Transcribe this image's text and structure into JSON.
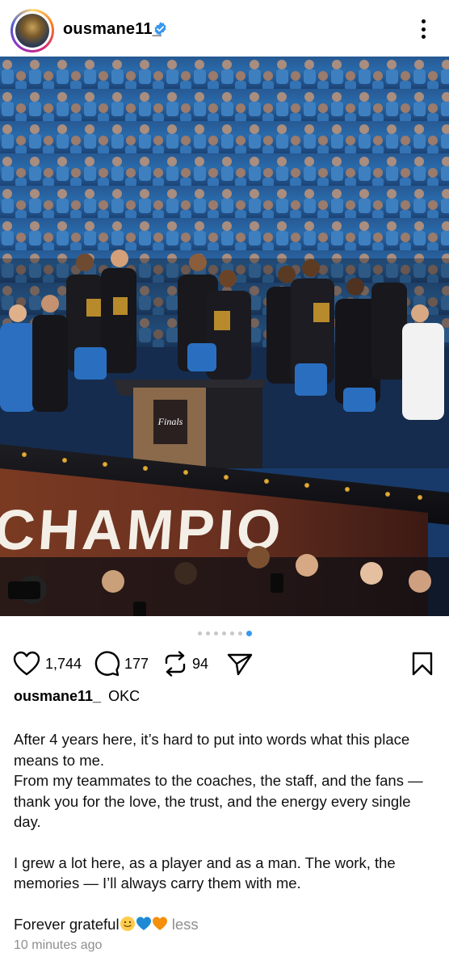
{
  "post": {
    "username": "ousmane11_",
    "location": "OKC",
    "image_banner_text": "CHAMPIO",
    "image_podium_label": "Finals",
    "carousel_total": 7,
    "carousel_active_index": 6,
    "likes": "1,744",
    "comments": "177",
    "reposts": "94",
    "caption": {
      "line1": "After 4 years here, it’s hard to put into words what this place means to me.",
      "line2": "From my teammates to the coaches, the staff, and the fans — thank you for the love, the trust, and the energy every single day.",
      "line3": "I grew a lot here, as a player and as a man. The work, the memories — I’ll always carry them with me.",
      "line4": "Forever grateful",
      "less": "less"
    },
    "timestamp": "10 minutes ago"
  },
  "colors": {
    "verified": "#3897f0",
    "carousel_active": "#3897f0",
    "muted": "#8e8e8e"
  },
  "icons": {
    "verified": "verified-badge-icon",
    "menu": "more-options-icon",
    "like": "heart-icon",
    "comment": "comment-bubble-icon",
    "repost": "repost-icon",
    "share": "send-icon",
    "save": "bookmark-icon",
    "emoji1": "slightly-smiling-face-emoji",
    "emoji2": "blue-heart-emoji",
    "emoji3": "orange-heart-emoji"
  }
}
